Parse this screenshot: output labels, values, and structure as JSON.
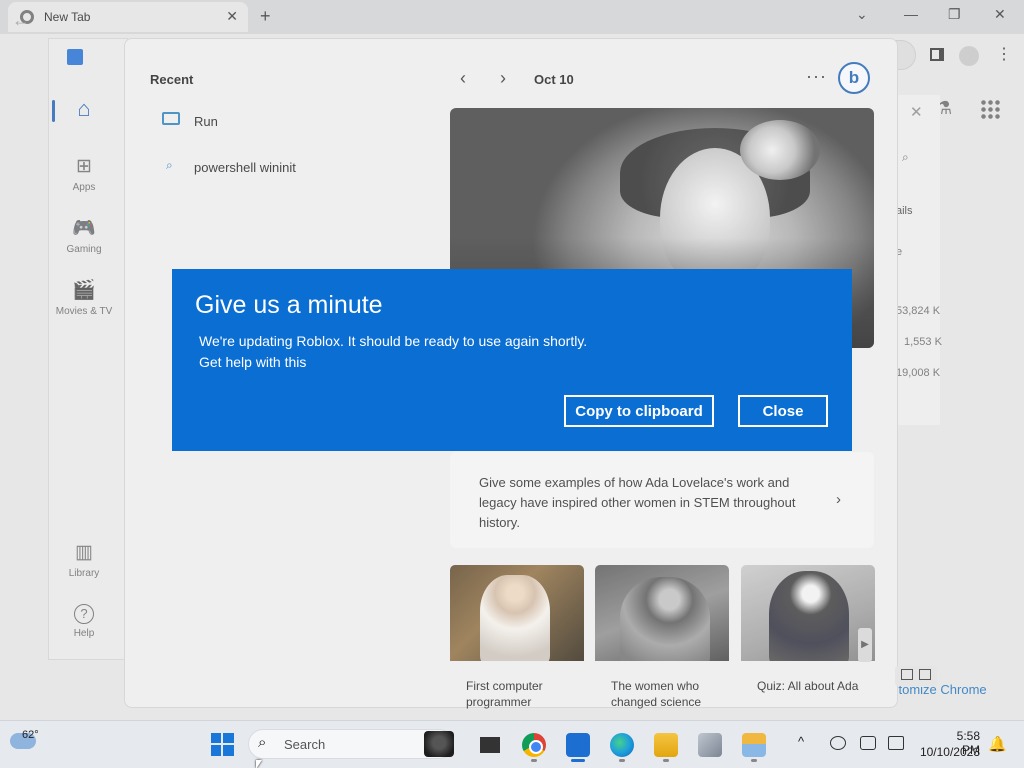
{
  "chrome": {
    "tab_title": "New Tab",
    "tab_close": "✕",
    "new_tab": "+",
    "minimize": "—",
    "restore": "❐",
    "close": "✕",
    "back": "←",
    "kebab": "⋮",
    "customize_label": "stomize Chrome",
    "flask": "⚗"
  },
  "task_manager": {
    "close": "✕",
    "search": "⌕",
    "details_label": "ails",
    "column_fragment": "e",
    "memory_values": [
      "53,824 K",
      "1,553 K",
      "19,008 K"
    ]
  },
  "store": {
    "nav": [
      {
        "label": "",
        "icon": "home-icon",
        "glyph": "⌂"
      },
      {
        "label": "Apps",
        "icon": "apps-icon",
        "glyph": "⊞"
      },
      {
        "label": "Gaming",
        "icon": "gamepad-icon",
        "glyph": "🎮"
      },
      {
        "label": "Movies & TV",
        "icon": "clapper-icon",
        "glyph": "🎬"
      },
      {
        "label": "Library",
        "icon": "library-icon",
        "glyph": "▥"
      },
      {
        "label": "Help",
        "icon": "help-icon",
        "glyph": "?"
      }
    ]
  },
  "start_menu": {
    "recent_title": "Recent",
    "recent_items": [
      {
        "label": "Run",
        "icon": "run-icon"
      },
      {
        "label": "powershell wininit",
        "icon": "search-icon"
      }
    ],
    "prev": "‹",
    "next": "›",
    "date": "Oct 10",
    "more": "···",
    "bing_glyph": "b",
    "prompt": "Give some examples of how Ada Lovelace's work and legacy have inspired other women in STEM throughout history.",
    "prompt_chevron": "›",
    "cards": [
      {
        "caption": "First computer programmer"
      },
      {
        "caption": "The women who changed science"
      },
      {
        "caption": "Quiz: All about Ada"
      }
    ],
    "thumb_next": "▶"
  },
  "dialog": {
    "title": "Give us a minute",
    "message": "We're updating Roblox. It should be ready to use again shortly.",
    "help_link": "Get help with this",
    "copy_button": "Copy to clipboard",
    "close_button": "Close",
    "background_color": "#0a6ed3"
  },
  "taskbar": {
    "weather_temp": "62°",
    "search_glyph": "⌕",
    "search_placeholder": "Search",
    "tray_chevron": "^",
    "time": "5:58 PM",
    "date": "10/10/2023",
    "bell": "🔔",
    "apps": [
      "task-view-icon",
      "chrome-icon",
      "store-icon",
      "edge-icon",
      "file-explorer-icon",
      "app-icon",
      "weather-app-icon"
    ]
  }
}
